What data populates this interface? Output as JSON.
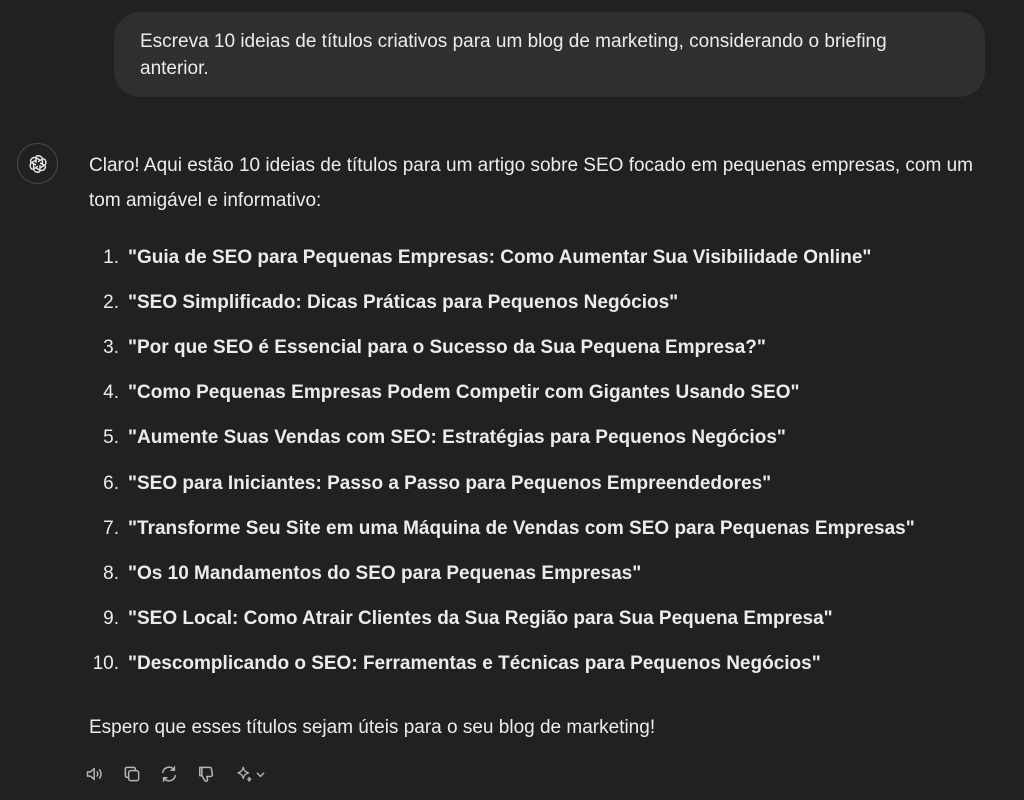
{
  "conversation": {
    "user_message": "Escreva 10 ideias de títulos criativos para um blog de marketing, considerando o briefing anterior.",
    "assistant": {
      "intro": "Claro! Aqui estão 10 ideias de títulos para um artigo sobre SEO focado em pequenas empresas, com um tom amigável e informativo:",
      "titles": [
        {
          "num": "1.",
          "text": "\"Guia de SEO para Pequenas Empresas: Como Aumentar Sua Visibilidade Online\""
        },
        {
          "num": "2.",
          "text": "\"SEO Simplificado: Dicas Práticas para Pequenos Negócios\""
        },
        {
          "num": "3.",
          "text": "\"Por que SEO é Essencial para o Sucesso da Sua Pequena Empresa?\""
        },
        {
          "num": "4.",
          "text": "\"Como Pequenas Empresas Podem Competir com Gigantes Usando SEO\""
        },
        {
          "num": "5.",
          "text": "\"Aumente Suas Vendas com SEO: Estratégias para Pequenos Negócios\""
        },
        {
          "num": "6.",
          "text": "\"SEO para Iniciantes: Passo a Passo para Pequenos Empreendedores\""
        },
        {
          "num": "7.",
          "text": "\"Transforme Seu Site em uma Máquina de Vendas com SEO para Pequenas Empresas\""
        },
        {
          "num": "8.",
          "text": "\"Os 10 Mandamentos do SEO para Pequenas Empresas\""
        },
        {
          "num": "9.",
          "text": "\"SEO Local: Como Atrair Clientes da Sua Região para Sua Pequena Empresa\""
        },
        {
          "num": "10.",
          "text": "\"Descomplicando o SEO: Ferramentas e Técnicas para Pequenos Negócios\""
        }
      ],
      "closing": "Espero que esses títulos sejam úteis para o seu blog de marketing!"
    }
  },
  "actions": [
    {
      "icon": "speaker-icon"
    },
    {
      "icon": "copy-icon"
    },
    {
      "icon": "regenerate-icon"
    },
    {
      "icon": "thumbs-down-icon"
    },
    {
      "icon": "sparkle-icon"
    }
  ],
  "colors": {
    "background": "#212121",
    "user_bubble": "#2f2f2f",
    "text": "#ececec",
    "icon": "#b4b4b4"
  }
}
